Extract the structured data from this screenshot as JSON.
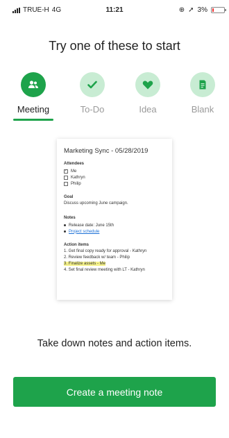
{
  "status_bar": {
    "carrier": "TRUE-H",
    "network": "4G",
    "time": "11:21",
    "battery": "3%"
  },
  "title": "Try one of these to start",
  "templates": [
    {
      "label": "Meeting",
      "icon": "meeting-people-icon",
      "active": true
    },
    {
      "label": "To-Do",
      "icon": "checkmark-icon",
      "active": false
    },
    {
      "label": "Idea",
      "icon": "heart-icon",
      "active": false
    },
    {
      "label": "Blank",
      "icon": "note-icon",
      "active": false
    }
  ],
  "preview": {
    "title": "Marketing Sync - 05/28/2019",
    "attendees_heading": "Attendees",
    "attendees": [
      {
        "name": "Me",
        "checked": true
      },
      {
        "name": "Kathryn",
        "checked": false
      },
      {
        "name": "Philip",
        "checked": false
      }
    ],
    "goal_heading": "Goal",
    "goal_text": "Discuss upcoming June campaign.",
    "notes_heading": "Notes",
    "notes": [
      {
        "text": "Release date: June 15th",
        "link": false
      },
      {
        "text": "Project schedule",
        "link": true
      }
    ],
    "action_heading": "Action items",
    "action_items": [
      {
        "text": "1. Get final copy ready for approval - Kathryn",
        "highlight": false
      },
      {
        "text": "2. Review feedback w/ team - Philip",
        "highlight": false
      },
      {
        "text": "3. Finalize assets - Me",
        "highlight": true
      },
      {
        "text": "4. Set final review meeting with LT - Kathryn",
        "highlight": false
      }
    ]
  },
  "caption": "Take down notes and action items.",
  "cta_label": "Create a meeting note",
  "colors": {
    "accent": "#1ea34b",
    "accent_light": "#c8ecd3",
    "highlight": "#f5f28a",
    "link": "#1a6fd6"
  }
}
